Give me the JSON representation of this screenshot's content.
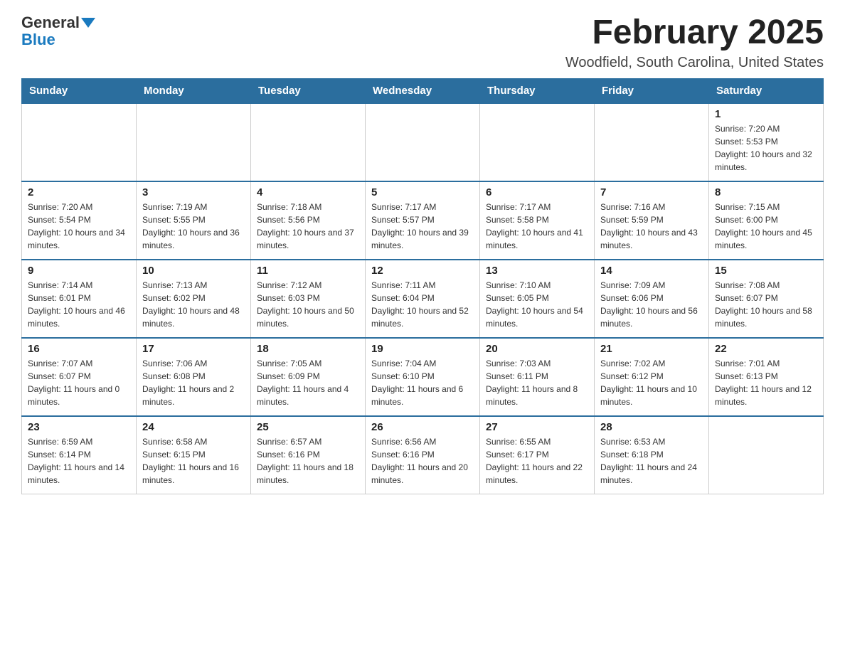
{
  "logo": {
    "general": "General",
    "blue": "Blue"
  },
  "title": "February 2025",
  "location": "Woodfield, South Carolina, United States",
  "days_of_week": [
    "Sunday",
    "Monday",
    "Tuesday",
    "Wednesday",
    "Thursday",
    "Friday",
    "Saturday"
  ],
  "weeks": [
    [
      {
        "day": "",
        "sunrise": "",
        "sunset": "",
        "daylight": ""
      },
      {
        "day": "",
        "sunrise": "",
        "sunset": "",
        "daylight": ""
      },
      {
        "day": "",
        "sunrise": "",
        "sunset": "",
        "daylight": ""
      },
      {
        "day": "",
        "sunrise": "",
        "sunset": "",
        "daylight": ""
      },
      {
        "day": "",
        "sunrise": "",
        "sunset": "",
        "daylight": ""
      },
      {
        "day": "",
        "sunrise": "",
        "sunset": "",
        "daylight": ""
      },
      {
        "day": "1",
        "sunrise": "Sunrise: 7:20 AM",
        "sunset": "Sunset: 5:53 PM",
        "daylight": "Daylight: 10 hours and 32 minutes."
      }
    ],
    [
      {
        "day": "2",
        "sunrise": "Sunrise: 7:20 AM",
        "sunset": "Sunset: 5:54 PM",
        "daylight": "Daylight: 10 hours and 34 minutes."
      },
      {
        "day": "3",
        "sunrise": "Sunrise: 7:19 AM",
        "sunset": "Sunset: 5:55 PM",
        "daylight": "Daylight: 10 hours and 36 minutes."
      },
      {
        "day": "4",
        "sunrise": "Sunrise: 7:18 AM",
        "sunset": "Sunset: 5:56 PM",
        "daylight": "Daylight: 10 hours and 37 minutes."
      },
      {
        "day": "5",
        "sunrise": "Sunrise: 7:17 AM",
        "sunset": "Sunset: 5:57 PM",
        "daylight": "Daylight: 10 hours and 39 minutes."
      },
      {
        "day": "6",
        "sunrise": "Sunrise: 7:17 AM",
        "sunset": "Sunset: 5:58 PM",
        "daylight": "Daylight: 10 hours and 41 minutes."
      },
      {
        "day": "7",
        "sunrise": "Sunrise: 7:16 AM",
        "sunset": "Sunset: 5:59 PM",
        "daylight": "Daylight: 10 hours and 43 minutes."
      },
      {
        "day": "8",
        "sunrise": "Sunrise: 7:15 AM",
        "sunset": "Sunset: 6:00 PM",
        "daylight": "Daylight: 10 hours and 45 minutes."
      }
    ],
    [
      {
        "day": "9",
        "sunrise": "Sunrise: 7:14 AM",
        "sunset": "Sunset: 6:01 PM",
        "daylight": "Daylight: 10 hours and 46 minutes."
      },
      {
        "day": "10",
        "sunrise": "Sunrise: 7:13 AM",
        "sunset": "Sunset: 6:02 PM",
        "daylight": "Daylight: 10 hours and 48 minutes."
      },
      {
        "day": "11",
        "sunrise": "Sunrise: 7:12 AM",
        "sunset": "Sunset: 6:03 PM",
        "daylight": "Daylight: 10 hours and 50 minutes."
      },
      {
        "day": "12",
        "sunrise": "Sunrise: 7:11 AM",
        "sunset": "Sunset: 6:04 PM",
        "daylight": "Daylight: 10 hours and 52 minutes."
      },
      {
        "day": "13",
        "sunrise": "Sunrise: 7:10 AM",
        "sunset": "Sunset: 6:05 PM",
        "daylight": "Daylight: 10 hours and 54 minutes."
      },
      {
        "day": "14",
        "sunrise": "Sunrise: 7:09 AM",
        "sunset": "Sunset: 6:06 PM",
        "daylight": "Daylight: 10 hours and 56 minutes."
      },
      {
        "day": "15",
        "sunrise": "Sunrise: 7:08 AM",
        "sunset": "Sunset: 6:07 PM",
        "daylight": "Daylight: 10 hours and 58 minutes."
      }
    ],
    [
      {
        "day": "16",
        "sunrise": "Sunrise: 7:07 AM",
        "sunset": "Sunset: 6:07 PM",
        "daylight": "Daylight: 11 hours and 0 minutes."
      },
      {
        "day": "17",
        "sunrise": "Sunrise: 7:06 AM",
        "sunset": "Sunset: 6:08 PM",
        "daylight": "Daylight: 11 hours and 2 minutes."
      },
      {
        "day": "18",
        "sunrise": "Sunrise: 7:05 AM",
        "sunset": "Sunset: 6:09 PM",
        "daylight": "Daylight: 11 hours and 4 minutes."
      },
      {
        "day": "19",
        "sunrise": "Sunrise: 7:04 AM",
        "sunset": "Sunset: 6:10 PM",
        "daylight": "Daylight: 11 hours and 6 minutes."
      },
      {
        "day": "20",
        "sunrise": "Sunrise: 7:03 AM",
        "sunset": "Sunset: 6:11 PM",
        "daylight": "Daylight: 11 hours and 8 minutes."
      },
      {
        "day": "21",
        "sunrise": "Sunrise: 7:02 AM",
        "sunset": "Sunset: 6:12 PM",
        "daylight": "Daylight: 11 hours and 10 minutes."
      },
      {
        "day": "22",
        "sunrise": "Sunrise: 7:01 AM",
        "sunset": "Sunset: 6:13 PM",
        "daylight": "Daylight: 11 hours and 12 minutes."
      }
    ],
    [
      {
        "day": "23",
        "sunrise": "Sunrise: 6:59 AM",
        "sunset": "Sunset: 6:14 PM",
        "daylight": "Daylight: 11 hours and 14 minutes."
      },
      {
        "day": "24",
        "sunrise": "Sunrise: 6:58 AM",
        "sunset": "Sunset: 6:15 PM",
        "daylight": "Daylight: 11 hours and 16 minutes."
      },
      {
        "day": "25",
        "sunrise": "Sunrise: 6:57 AM",
        "sunset": "Sunset: 6:16 PM",
        "daylight": "Daylight: 11 hours and 18 minutes."
      },
      {
        "day": "26",
        "sunrise": "Sunrise: 6:56 AM",
        "sunset": "Sunset: 6:16 PM",
        "daylight": "Daylight: 11 hours and 20 minutes."
      },
      {
        "day": "27",
        "sunrise": "Sunrise: 6:55 AM",
        "sunset": "Sunset: 6:17 PM",
        "daylight": "Daylight: 11 hours and 22 minutes."
      },
      {
        "day": "28",
        "sunrise": "Sunrise: 6:53 AM",
        "sunset": "Sunset: 6:18 PM",
        "daylight": "Daylight: 11 hours and 24 minutes."
      },
      {
        "day": "",
        "sunrise": "",
        "sunset": "",
        "daylight": ""
      }
    ]
  ]
}
